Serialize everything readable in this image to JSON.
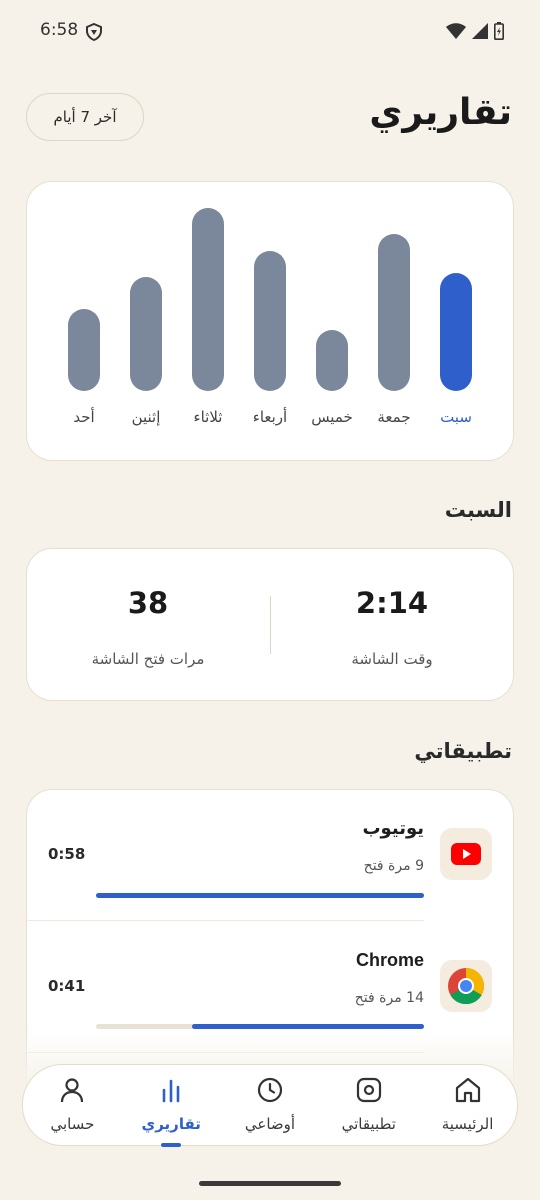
{
  "status_bar": {
    "time": "6:58"
  },
  "header": {
    "title": "تقاريري",
    "range": "آخر 7 أيام"
  },
  "chart_data": {
    "type": "bar",
    "categories": [
      "أحد",
      "إثنين",
      "ثلاثاء",
      "أربعاء",
      "خميس",
      "جمعة",
      "سبت"
    ],
    "values": [
      82,
      114,
      183,
      140,
      61,
      157,
      118
    ],
    "ymax": 200,
    "active_index": 6,
    "colors": {
      "bar": "#7B879A",
      "active": "#2F5FCB"
    }
  },
  "day_section": {
    "title": "السبت"
  },
  "stats": {
    "screen_time": {
      "value": "2:14",
      "label": "وقت الشاشة"
    },
    "unlocks": {
      "value": "38",
      "label": "مرات فتح الشاشة"
    }
  },
  "apps_section": {
    "title": "تطبيقاتي"
  },
  "apps": [
    {
      "name": "يوتيوب",
      "opens": "9 مرة فتح",
      "time": "0:58",
      "fraction": 1.0,
      "icon": "youtube-icon"
    },
    {
      "name": "Chrome",
      "opens": "14 مرة فتح",
      "time": "0:41",
      "fraction": 0.707,
      "icon": "chrome-icon"
    }
  ],
  "nav": {
    "items": [
      {
        "label": "الرئيسية",
        "icon": "home-icon"
      },
      {
        "label": "تطبيقاتي",
        "icon": "apps-icon"
      },
      {
        "label": "أوضاعي",
        "icon": "clock-icon"
      },
      {
        "label": "تقاريري",
        "icon": "chart-icon"
      },
      {
        "label": "حسابي",
        "icon": "profile-icon"
      }
    ],
    "active_index": 3
  },
  "colors": {
    "accent": "#2F5FCB",
    "background": "#F6F2E9"
  }
}
